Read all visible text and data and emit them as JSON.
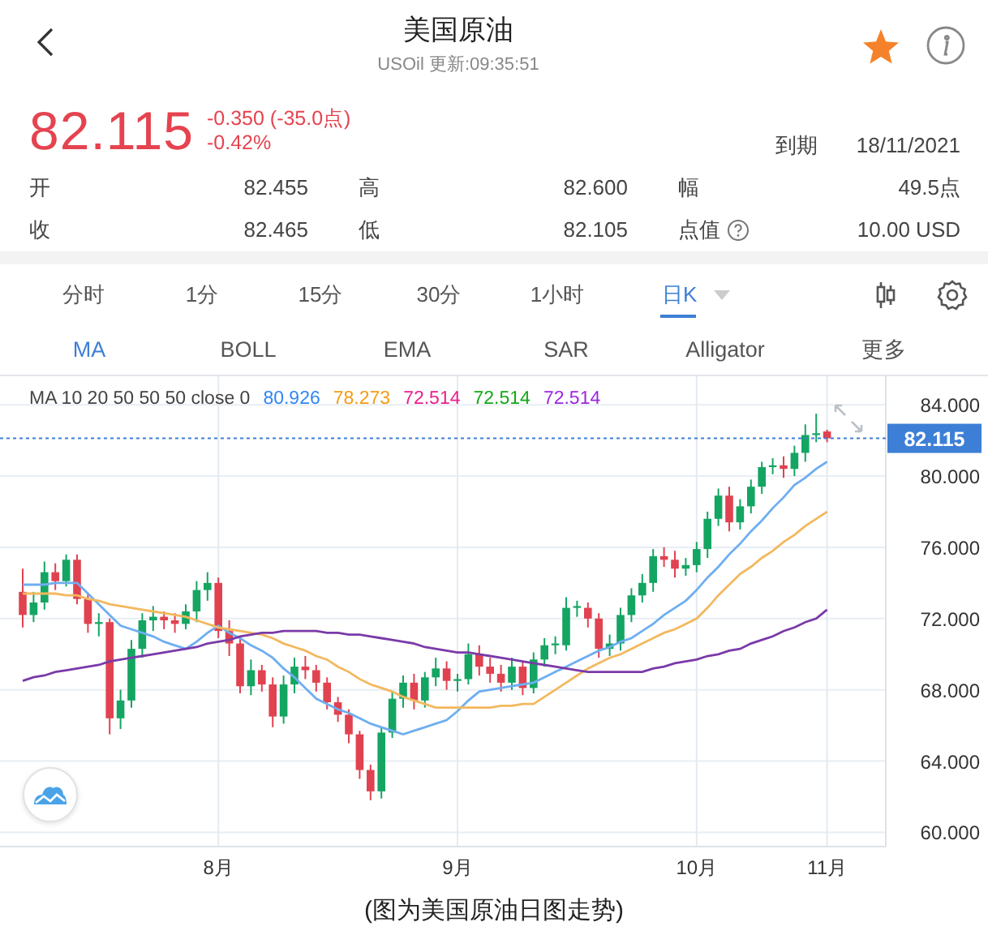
{
  "header": {
    "title": "美国原油",
    "subtitle": "USOil 更新:09:35:51",
    "favorited": true
  },
  "quote": {
    "price": "82.115",
    "change": "-0.350 (-35.0点)",
    "change_percent": "-0.42%",
    "expiry_label": "到期",
    "expiry": "18/11/2021"
  },
  "stats": [
    {
      "items": [
        {
          "label": "开",
          "value": "82.455"
        },
        {
          "label": "高",
          "value": "82.600"
        },
        {
          "label": "幅",
          "value": "49.5点"
        }
      ]
    },
    {
      "items": [
        {
          "label": "收",
          "value": "82.465"
        },
        {
          "label": "低",
          "value": "82.105"
        },
        {
          "label": "点值",
          "value": "10.00 USD",
          "help": true
        }
      ]
    }
  ],
  "timeframes": [
    {
      "label": "分时",
      "selected": false,
      "menu": false
    },
    {
      "label": "1分",
      "selected": false,
      "menu": false
    },
    {
      "label": "15分",
      "selected": false,
      "menu": false
    },
    {
      "label": "30分",
      "selected": false,
      "menu": false
    },
    {
      "label": "1小时",
      "selected": false,
      "menu": false
    },
    {
      "label": "日K",
      "selected": true,
      "menu": true
    }
  ],
  "indicators": [
    {
      "label": "MA",
      "selected": true
    },
    {
      "label": "BOLL",
      "selected": false
    },
    {
      "label": "EMA",
      "selected": false
    },
    {
      "label": "SAR",
      "selected": false
    },
    {
      "label": "Alligator",
      "selected": false
    },
    {
      "label": "更多",
      "selected": false
    }
  ],
  "chart": {
    "legend": {
      "label": "MA  10 20 50 50 50 close 0",
      "values": [
        {
          "text": "80.926",
          "color": "#2f86f6"
        },
        {
          "text": "78.273",
          "color": "#f39c12"
        },
        {
          "text": "72.514",
          "color": "#e91e8c"
        },
        {
          "text": "72.514",
          "color": "#14a814"
        },
        {
          "text": "72.514",
          "color": "#9c27e0"
        }
      ]
    },
    "chart_data": {
      "type": "candlestick",
      "grid": true,
      "ylim": [
        59.2,
        85.6
      ],
      "yticks": [
        {
          "value": 60,
          "label": "60.000"
        },
        {
          "value": 64,
          "label": "64.000"
        },
        {
          "value": 68,
          "label": "68.000"
        },
        {
          "value": 72,
          "label": "72.000"
        },
        {
          "value": 76,
          "label": "76.000"
        },
        {
          "value": 80,
          "label": "80.000"
        },
        {
          "value": 84,
          "label": "84.000"
        }
      ],
      "categories": [
        null,
        null,
        null,
        null,
        null,
        null,
        null,
        null,
        null,
        null,
        null,
        null,
        null,
        null,
        null,
        null,
        null,
        null,
        "8月",
        null,
        null,
        null,
        null,
        null,
        null,
        null,
        null,
        null,
        null,
        null,
        null,
        null,
        null,
        null,
        null,
        null,
        null,
        null,
        null,
        null,
        "9月",
        null,
        null,
        null,
        null,
        null,
        null,
        null,
        null,
        null,
        null,
        null,
        null,
        null,
        null,
        null,
        null,
        null,
        null,
        null,
        null,
        null,
        "10月",
        null,
        null,
        null,
        null,
        null,
        null,
        null,
        null,
        null,
        null,
        null,
        "11月"
      ],
      "ohlc": [
        [
          73.5,
          74.8,
          71.5,
          72.2
        ],
        [
          72.2,
          73.5,
          71.8,
          72.9
        ],
        [
          72.9,
          75.2,
          72.5,
          74.6
        ],
        [
          74.6,
          75.1,
          73.6,
          74.1
        ],
        [
          74.1,
          75.6,
          73.8,
          75.3
        ],
        [
          75.3,
          75.6,
          72.8,
          73.1
        ],
        [
          73.1,
          73.4,
          71.2,
          71.7
        ],
        [
          71.7,
          72.3,
          71.0,
          71.8
        ],
        [
          71.8,
          72.0,
          65.5,
          66.4
        ],
        [
          66.4,
          68.0,
          65.8,
          67.4
        ],
        [
          67.4,
          70.8,
          67.0,
          70.3
        ],
        [
          70.3,
          72.3,
          69.8,
          71.9
        ],
        [
          71.9,
          72.7,
          71.3,
          72.1
        ],
        [
          72.1,
          72.4,
          71.4,
          71.9
        ],
        [
          71.9,
          72.3,
          71.2,
          71.7
        ],
        [
          71.7,
          72.8,
          71.4,
          72.4
        ],
        [
          72.4,
          74.1,
          71.8,
          73.6
        ],
        [
          73.6,
          74.6,
          73.0,
          74.0
        ],
        [
          74.0,
          74.3,
          70.9,
          71.3
        ],
        [
          71.3,
          71.9,
          69.9,
          70.6
        ],
        [
          70.6,
          70.9,
          67.8,
          68.2
        ],
        [
          68.2,
          69.7,
          67.7,
          69.1
        ],
        [
          69.1,
          69.4,
          67.9,
          68.3
        ],
        [
          68.3,
          68.7,
          65.9,
          66.5
        ],
        [
          66.5,
          68.8,
          66.1,
          68.3
        ],
        [
          68.3,
          69.8,
          67.8,
          69.3
        ],
        [
          69.3,
          69.9,
          68.6,
          69.1
        ],
        [
          69.1,
          69.4,
          67.9,
          68.4
        ],
        [
          68.4,
          68.7,
          66.9,
          67.3
        ],
        [
          67.3,
          67.6,
          66.2,
          66.6
        ],
        [
          66.6,
          66.9,
          65.0,
          65.5
        ],
        [
          65.5,
          65.7,
          63.0,
          63.5
        ],
        [
          63.5,
          63.8,
          61.8,
          62.3
        ],
        [
          62.3,
          65.9,
          61.9,
          65.6
        ],
        [
          65.6,
          67.9,
          65.3,
          67.5
        ],
        [
          67.5,
          68.8,
          67.0,
          68.4
        ],
        [
          68.4,
          68.9,
          66.9,
          67.4
        ],
        [
          67.4,
          69.0,
          67.0,
          68.7
        ],
        [
          68.7,
          69.8,
          68.2,
          69.2
        ],
        [
          69.2,
          69.6,
          68.0,
          68.5
        ],
        [
          68.5,
          68.9,
          67.9,
          68.6
        ],
        [
          68.6,
          70.6,
          68.3,
          70.0
        ],
        [
          70.0,
          70.5,
          68.8,
          69.3
        ],
        [
          69.3,
          69.8,
          68.4,
          68.9
        ],
        [
          68.9,
          69.4,
          67.9,
          68.4
        ],
        [
          68.4,
          69.8,
          68.0,
          69.3
        ],
        [
          69.3,
          69.6,
          67.7,
          68.1
        ],
        [
          68.1,
          70.1,
          67.8,
          69.7
        ],
        [
          69.7,
          70.9,
          69.3,
          70.5
        ],
        [
          70.5,
          71.0,
          70.0,
          70.6
        ],
        [
          70.5,
          73.2,
          70.2,
          72.6
        ],
        [
          72.6,
          73.0,
          72.1,
          72.7
        ],
        [
          72.6,
          72.9,
          71.5,
          72.0
        ],
        [
          72.0,
          72.3,
          69.8,
          70.3
        ],
        [
          70.3,
          71.1,
          69.9,
          70.6
        ],
        [
          70.6,
          72.6,
          70.2,
          72.2
        ],
        [
          72.2,
          73.7,
          71.8,
          73.3
        ],
        [
          73.3,
          74.5,
          72.9,
          74.0
        ],
        [
          74.0,
          75.9,
          73.5,
          75.5
        ],
        [
          75.5,
          76.0,
          74.9,
          75.3
        ],
        [
          75.3,
          75.8,
          74.3,
          74.8
        ],
        [
          74.8,
          75.4,
          74.4,
          75.0
        ],
        [
          75.0,
          76.3,
          74.6,
          75.9
        ],
        [
          75.9,
          78.0,
          75.4,
          77.6
        ],
        [
          77.6,
          79.3,
          77.2,
          78.9
        ],
        [
          78.9,
          79.4,
          76.9,
          77.4
        ],
        [
          77.4,
          78.7,
          77.0,
          78.3
        ],
        [
          78.3,
          79.8,
          77.9,
          79.4
        ],
        [
          79.4,
          80.8,
          79.0,
          80.5
        ],
        [
          80.5,
          81.0,
          80.1,
          80.6
        ],
        [
          80.6,
          81.1,
          79.9,
          80.4
        ],
        [
          80.4,
          81.7,
          80.0,
          81.3
        ],
        [
          81.3,
          82.9,
          80.8,
          82.3
        ],
        [
          82.3,
          83.5,
          81.9,
          82.4
        ],
        [
          82.5,
          82.6,
          81.9,
          82.115
        ]
      ],
      "ref_lines": [
        {
          "axis": "y",
          "value": 82.115,
          "label": "82.115"
        }
      ],
      "series": [
        {
          "type": "line",
          "color": "#6eaef0",
          "values": [
            73.9,
            73.9,
            73.9,
            74.0,
            74.0,
            74.0,
            73.4,
            72.8,
            72.2,
            71.6,
            71.4,
            71.2,
            71.0,
            70.7,
            70.5,
            70.3,
            70.7,
            71.2,
            71.6,
            71.2,
            70.9,
            70.5,
            70.2,
            69.8,
            69.2,
            68.7,
            68.1,
            67.5,
            67.2,
            66.9,
            66.7,
            66.4,
            66.1,
            65.9,
            65.7,
            65.5,
            65.7,
            65.9,
            66.1,
            66.3,
            66.8,
            67.4,
            67.9,
            68.0,
            68.1,
            68.2,
            68.3,
            68.4,
            68.7,
            69.0,
            69.3,
            69.6,
            69.9,
            70.2,
            70.4,
            70.7,
            70.9,
            71.3,
            71.7,
            72.2,
            72.6,
            73.0,
            73.6,
            74.3,
            74.9,
            75.6,
            76.2,
            76.9,
            77.5,
            78.2,
            78.8,
            79.5,
            79.9,
            80.4,
            80.8
          ]
        },
        {
          "type": "line",
          "color": "#f3b85e",
          "values": [
            73.4,
            73.4,
            73.4,
            73.4,
            73.3,
            73.3,
            73.1,
            73.0,
            72.8,
            72.7,
            72.6,
            72.5,
            72.4,
            72.3,
            72.2,
            72.1,
            71.9,
            71.7,
            71.5,
            71.4,
            71.3,
            71.2,
            71.1,
            70.9,
            70.6,
            70.4,
            70.2,
            69.9,
            69.7,
            69.3,
            69.0,
            68.6,
            68.3,
            68.1,
            67.9,
            67.6,
            67.4,
            67.2,
            67.0,
            67.0,
            67.0,
            67.0,
            67.0,
            67.0,
            67.1,
            67.1,
            67.2,
            67.2,
            67.6,
            68.0,
            68.4,
            68.8,
            69.2,
            69.5,
            69.8,
            70.0,
            70.3,
            70.6,
            70.9,
            71.2,
            71.4,
            71.7,
            72.0,
            72.6,
            73.3,
            73.9,
            74.5,
            74.9,
            75.4,
            75.8,
            76.3,
            76.7,
            77.2,
            77.6,
            78.0
          ]
        },
        {
          "type": "line",
          "color": "#7a3aa8",
          "values": [
            68.5,
            68.7,
            68.8,
            69.0,
            69.1,
            69.2,
            69.3,
            69.4,
            69.6,
            69.7,
            69.8,
            69.9,
            70.0,
            70.1,
            70.2,
            70.3,
            70.4,
            70.6,
            70.7,
            70.8,
            71.0,
            71.1,
            71.2,
            71.2,
            71.3,
            71.3,
            71.3,
            71.3,
            71.2,
            71.2,
            71.1,
            71.1,
            71.0,
            70.9,
            70.8,
            70.7,
            70.6,
            70.4,
            70.3,
            70.2,
            70.1,
            70.1,
            70.0,
            69.9,
            69.8,
            69.7,
            69.6,
            69.5,
            69.4,
            69.3,
            69.2,
            69.1,
            69.0,
            69.0,
            69.0,
            69.0,
            69.0,
            69.0,
            69.2,
            69.3,
            69.5,
            69.6,
            69.7,
            69.9,
            70.0,
            70.2,
            70.3,
            70.6,
            70.8,
            71.0,
            71.3,
            71.5,
            71.8,
            72.0,
            72.5
          ]
        }
      ]
    }
  },
  "caption": "(图为美国原油日图走势)"
}
